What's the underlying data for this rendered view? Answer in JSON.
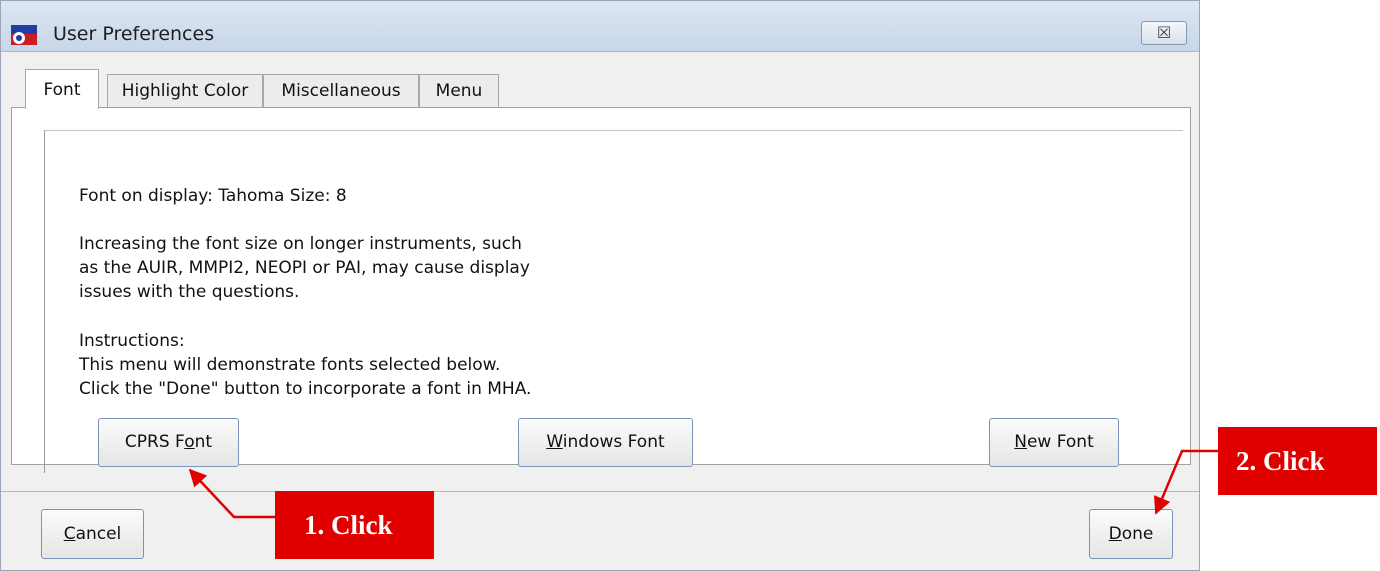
{
  "window": {
    "title": "User Preferences",
    "close_label": "☒"
  },
  "tabs": [
    {
      "label": "Font",
      "active": true
    },
    {
      "label": "Highlight Color",
      "active": false
    },
    {
      "label": "Miscellaneous",
      "active": false
    },
    {
      "label": "Menu",
      "active": false
    }
  ],
  "font_panel": {
    "font_info": "Font on display: Tahoma   Size: 8",
    "warning_lines": [
      "Increasing the font size on longer instruments, such",
      "as the AUIR, MMPI2, NEOPI or PAI, may cause display",
      "issues with the questions."
    ],
    "instructions_lines": [
      "Instructions:",
      "This menu will demonstrate fonts selected below.",
      "Click the \"Done\" button to incorporate a font in MHA."
    ],
    "buttons": {
      "cprs_font": {
        "pre": "CPRS F",
        "key": "o",
        "post": "nt"
      },
      "windows_font": {
        "pre": "",
        "key": "W",
        "post": "indows Font"
      },
      "new_font": {
        "pre": "",
        "key": "N",
        "post": "ew Font"
      }
    }
  },
  "footer": {
    "cancel": {
      "pre": "",
      "key": "C",
      "post": "ancel"
    },
    "done": {
      "pre": "",
      "key": "D",
      "post": "one"
    }
  },
  "annotations": {
    "step1": "1. Click",
    "step2": "2. Click",
    "color": "#e00000"
  }
}
